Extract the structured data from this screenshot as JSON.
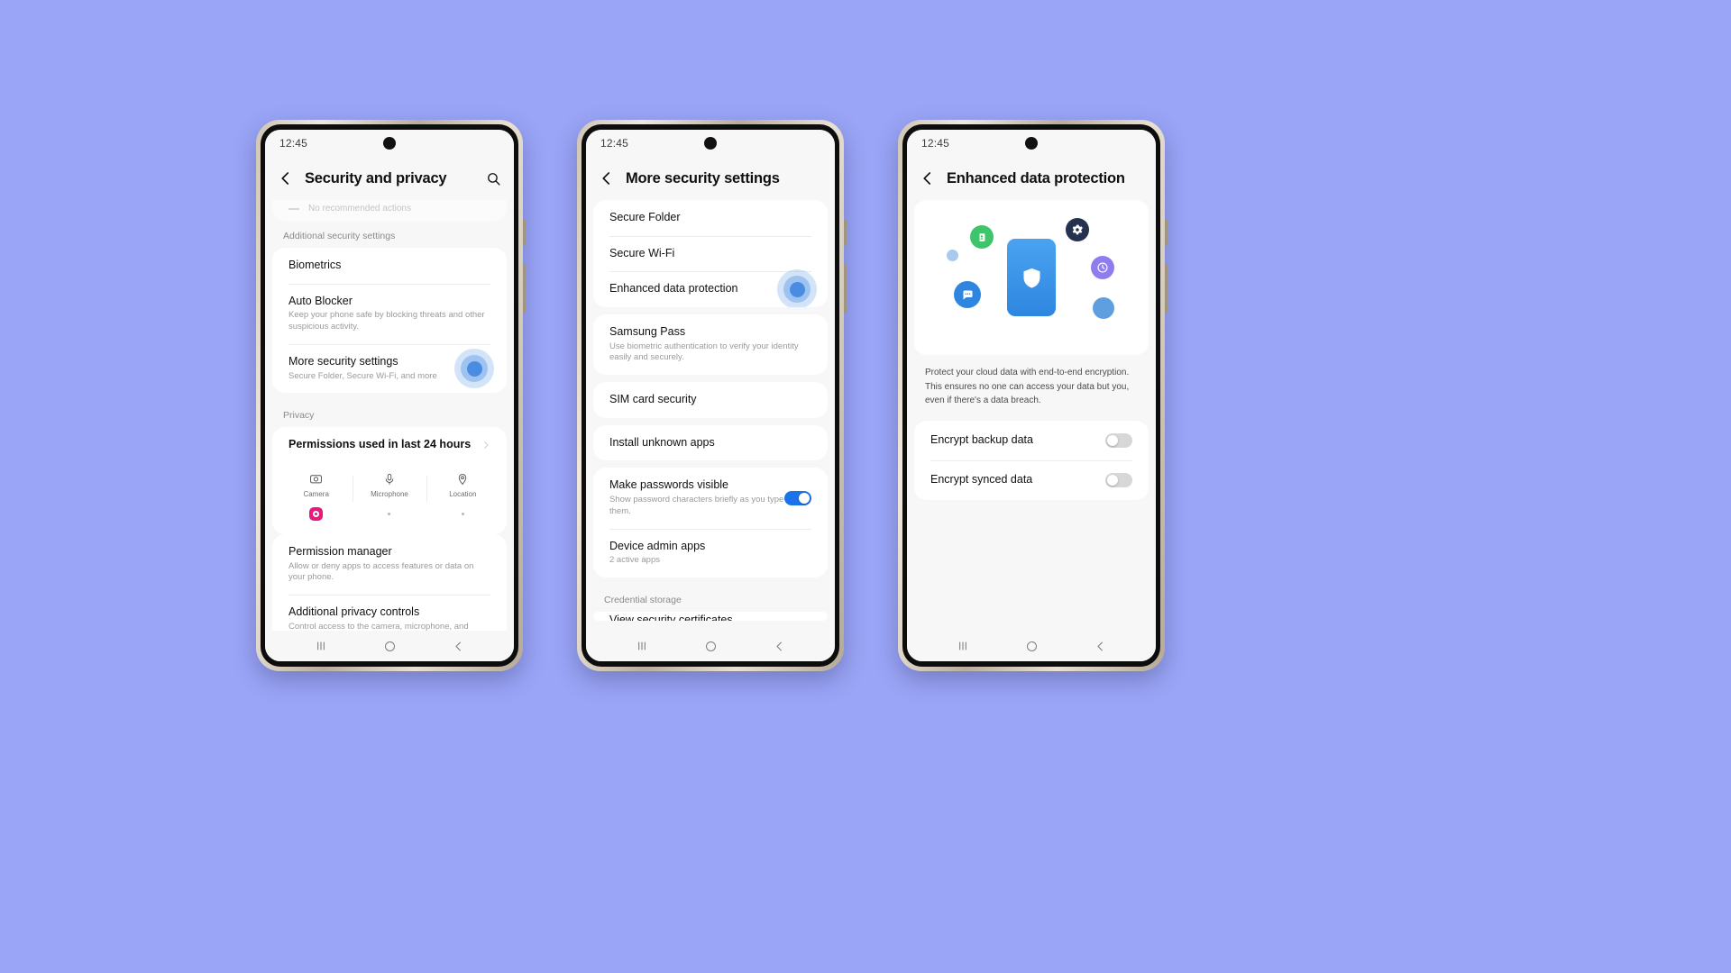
{
  "background_color": "#9aa5f7",
  "accent_color": "#1a73e8",
  "ripple_color": "#3c82e1",
  "phones": [
    {
      "id": "phone-security-privacy",
      "status": {
        "clock": "12:45"
      },
      "appbar": {
        "back_icon": "chevron-left-icon",
        "title": "Security and privacy",
        "search_icon": "search-icon"
      },
      "faded_row": {
        "text": "No recommended actions"
      },
      "group_additional": "Additional security settings",
      "rows": [
        {
          "title": "Biometrics",
          "sub": ""
        },
        {
          "title": "Auto Blocker",
          "sub": "Keep your phone safe by blocking threats and other suspicious activity."
        },
        {
          "title": "More security settings",
          "sub": "Secure Folder, Secure Wi-Fi, and more"
        }
      ],
      "group_privacy": "Privacy",
      "permissions_row": {
        "title": "Permissions used in last 24 hours",
        "chevron": "chevron-right-icon"
      },
      "permissions": [
        {
          "label": "Camera",
          "icon": "camera-icon",
          "active": true
        },
        {
          "label": "Microphone",
          "icon": "microphone-icon",
          "active": false
        },
        {
          "label": "Location",
          "icon": "location-pin-icon",
          "active": false
        }
      ],
      "bottom_rows": [
        {
          "title": "Permission manager",
          "sub": "Allow or deny apps to access features or data on your phone."
        },
        {
          "title": "Additional privacy controls",
          "sub": "Control access to the camera, microphone, and clipboard."
        }
      ],
      "navbar": [
        "recents-icon",
        "home-icon",
        "back-icon"
      ]
    },
    {
      "id": "phone-more-security-settings",
      "status": {
        "clock": "12:45"
      },
      "appbar": {
        "back_icon": "chevron-left-icon",
        "title": "More security settings"
      },
      "rows": [
        {
          "title": "Secure Folder",
          "sub": ""
        },
        {
          "title": "Secure Wi-Fi",
          "sub": ""
        },
        {
          "title": "Enhanced data protection",
          "sub": ""
        },
        {
          "title": "Samsung Pass",
          "sub": "Use biometric authentication to verify your identity easily and securely."
        },
        {
          "title": "SIM card security",
          "sub": ""
        },
        {
          "title": "Install unknown apps",
          "sub": ""
        },
        {
          "title": "Make passwords visible",
          "sub": "Show password characters briefly as you type them.",
          "toggle": "on"
        },
        {
          "title": "Device admin apps",
          "sub": "2 active apps"
        }
      ],
      "group_credential": "Credential storage",
      "clipped_row": "View security certificates",
      "navbar": [
        "recents-icon",
        "home-icon",
        "back-icon"
      ]
    },
    {
      "id": "phone-enhanced-data-protection",
      "status": {
        "clock": "12:45"
      },
      "appbar": {
        "back_icon": "chevron-left-icon",
        "title": "Enhanced data protection"
      },
      "hero": {
        "shield_icon": "shield-icon",
        "bubbles": [
          {
            "name": "contacts-bubble-icon",
            "color": "#34c759"
          },
          {
            "name": "settings-gear-bubble-icon",
            "color": "#1f3b63"
          },
          {
            "name": "clock-bubble-icon",
            "color": "#8e7cf0"
          },
          {
            "name": "message-bubble-icon",
            "color": "#2f86e0"
          },
          {
            "name": "plain-dot-bubble-left",
            "color": "#9dc4ee"
          },
          {
            "name": "plain-dot-bubble-right",
            "color": "#5f9fe0"
          }
        ]
      },
      "intro": "Protect your cloud data with end-to-end encryption. This ensures no one can access your data but you, even if there's a data breach.",
      "rows": [
        {
          "title": "Encrypt backup data",
          "toggle": "off"
        },
        {
          "title": "Encrypt synced data",
          "toggle": "off"
        }
      ],
      "navbar": [
        "recents-icon",
        "home-icon",
        "back-icon"
      ]
    }
  ]
}
